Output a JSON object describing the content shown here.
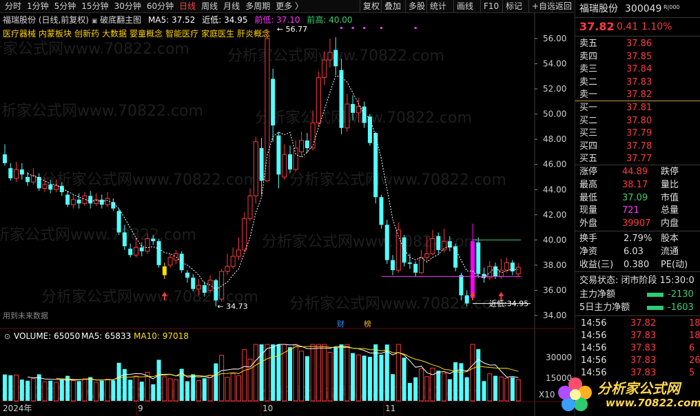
{
  "toolbar": {
    "timeframes": [
      "分时",
      "1分钟",
      "5分钟",
      "15分钟",
      "30分钟",
      "60分钟",
      "日线",
      "周线",
      "月线",
      "多周期",
      "更多 〉"
    ],
    "active_index": 6,
    "right_buttons": [
      "复权",
      "叠加",
      "多股",
      "统计",
      "画线",
      "F10",
      "标记",
      "+自选",
      "返回"
    ]
  },
  "header": {
    "stock_title": "福瑞股份 (日线,前复权)",
    "indicator": "破底翻主图",
    "ma5": "MA5: 37.52",
    "near_low": "近低: 34.95",
    "prev_low": "前低: 37.10",
    "prev_high": "前高: 40.00"
  },
  "tags": [
    "医疗器械",
    "内蒙板块",
    "创新药",
    "大数据",
    "婴童概念",
    "智能医疗",
    "家庭医生",
    "肝炎概念"
  ],
  "annotations": {
    "high_label": "56.77",
    "low_label": "34.73",
    "near_low_label": "近低:34.95",
    "future_data": "用到未来数据",
    "marker_cai": "财",
    "marker_bang": "榜"
  },
  "chart_data": [
    {
      "type": "candlestick",
      "ylim": [
        33.5,
        57
      ],
      "y_ticks": [
        "56.00",
        "54.00",
        "52.00",
        "50.00",
        "48.00",
        "46.00",
        "44.00",
        "42.00",
        "40.00",
        "38.00",
        "36.00",
        "34.00"
      ],
      "x_labels": [
        "2024年",
        "9",
        "10",
        "11"
      ],
      "candles": [
        {
          "o": 46.8,
          "c": 46.1,
          "h": 47.6,
          "l": 45.9
        },
        {
          "o": 45.7,
          "c": 44.9,
          "h": 46.1,
          "l": 44.7
        },
        {
          "o": 44.9,
          "c": 45.6,
          "h": 46.2,
          "l": 44.6
        },
        {
          "o": 45.6,
          "c": 45.2,
          "h": 46.1,
          "l": 44.8
        },
        {
          "o": 45.0,
          "c": 44.6,
          "h": 45.4,
          "l": 44.3
        },
        {
          "o": 44.6,
          "c": 45.1,
          "h": 45.7,
          "l": 44.4
        },
        {
          "o": 45.0,
          "c": 44.1,
          "h": 45.3,
          "l": 43.9
        },
        {
          "o": 44.1,
          "c": 44.4,
          "h": 44.9,
          "l": 43.8
        },
        {
          "o": 44.4,
          "c": 44.0,
          "h": 44.8,
          "l": 43.7
        },
        {
          "o": 44.0,
          "c": 44.3,
          "h": 44.8,
          "l": 43.8
        },
        {
          "o": 44.3,
          "c": 43.8,
          "h": 44.6,
          "l": 43.5
        },
        {
          "o": 43.6,
          "c": 42.8,
          "h": 43.9,
          "l": 42.6
        },
        {
          "o": 42.8,
          "c": 43.2,
          "h": 43.6,
          "l": 42.5
        },
        {
          "o": 43.2,
          "c": 42.9,
          "h": 43.7,
          "l": 42.5
        },
        {
          "o": 42.9,
          "c": 43.5,
          "h": 43.8,
          "l": 42.7
        },
        {
          "o": 43.5,
          "c": 42.9,
          "h": 43.9,
          "l": 42.5
        },
        {
          "o": 42.9,
          "c": 43.2,
          "h": 43.7,
          "l": 42.7
        },
        {
          "o": 43.2,
          "c": 42.8,
          "h": 43.6,
          "l": 42.5
        },
        {
          "o": 42.8,
          "c": 43.3,
          "h": 43.8,
          "l": 42.6
        },
        {
          "o": 43.0,
          "c": 42.5,
          "h": 43.3,
          "l": 42.3
        },
        {
          "o": 42.3,
          "c": 40.6,
          "h": 42.5,
          "l": 40.4
        },
        {
          "o": 40.6,
          "c": 39.5,
          "h": 41.2,
          "l": 39.2
        },
        {
          "o": 39.3,
          "c": 38.8,
          "h": 39.7,
          "l": 38.6
        },
        {
          "o": 38.8,
          "c": 39.4,
          "h": 40.2,
          "l": 38.6
        },
        {
          "o": 39.4,
          "c": 39.1,
          "h": 39.8,
          "l": 38.7
        },
        {
          "o": 39.1,
          "c": 40.1,
          "h": 40.5,
          "l": 38.9
        },
        {
          "o": 40.1,
          "c": 39.9,
          "h": 40.4,
          "l": 39.6
        },
        {
          "o": 39.9,
          "c": 38.0,
          "h": 40.1,
          "l": 37.8
        },
        {
          "o": 37.2,
          "c": 37.9,
          "h": 38.2,
          "l": 36.9,
          "color": "#ffe000"
        },
        {
          "o": 38.0,
          "c": 38.6,
          "h": 38.9,
          "l": 37.8
        },
        {
          "o": 38.4,
          "c": 38.9,
          "h": 39.2,
          "l": 38.1
        },
        {
          "o": 38.9,
          "c": 37.6,
          "h": 39.1,
          "l": 37.4
        },
        {
          "o": 37.4,
          "c": 37.0,
          "h": 37.6,
          "l": 36.6
        },
        {
          "o": 37.0,
          "c": 36.1,
          "h": 37.3,
          "l": 35.9
        },
        {
          "o": 36.1,
          "c": 36.4,
          "h": 36.9,
          "l": 35.6
        },
        {
          "o": 36.4,
          "c": 35.8,
          "h": 36.7,
          "l": 35.5
        },
        {
          "o": 36.0,
          "c": 36.8,
          "h": 37.2,
          "l": 35.8
        },
        {
          "o": 36.8,
          "c": 35.2,
          "h": 36.9,
          "l": 34.73
        },
        {
          "o": 35.3,
          "c": 37.5,
          "h": 37.7,
          "l": 35.1
        },
        {
          "o": 37.5,
          "c": 37.9,
          "h": 38.9,
          "l": 37.2
        },
        {
          "o": 37.9,
          "c": 38.7,
          "h": 39.4,
          "l": 37.7
        },
        {
          "o": 38.7,
          "c": 39.2,
          "h": 40.2,
          "l": 38.4
        },
        {
          "o": 39.2,
          "c": 41.7,
          "h": 42.2,
          "l": 39.1
        },
        {
          "o": 41.7,
          "c": 43.5,
          "h": 44.1,
          "l": 41.5
        },
        {
          "o": 43.5,
          "c": 47.8,
          "h": 48.2,
          "l": 42.9
        },
        {
          "o": 47.3,
          "c": 44.7,
          "h": 48.1,
          "l": 43.6
        },
        {
          "o": 44.7,
          "c": 56.0,
          "h": 56.77,
          "l": 44.6
        },
        {
          "o": 52.8,
          "c": 49.1,
          "h": 53.6,
          "l": 47.8
        },
        {
          "o": 48.3,
          "c": 45.2,
          "h": 48.6,
          "l": 44.1
        },
        {
          "o": 45.0,
          "c": 46.8,
          "h": 47.6,
          "l": 44.8
        },
        {
          "o": 46.8,
          "c": 45.6,
          "h": 47.5,
          "l": 45.3
        },
        {
          "o": 45.6,
          "c": 47.3,
          "h": 47.9,
          "l": 45.4
        },
        {
          "o": 47.0,
          "c": 47.9,
          "h": 48.6,
          "l": 46.6
        },
        {
          "o": 47.9,
          "c": 47.3,
          "h": 48.5,
          "l": 46.9
        },
        {
          "o": 47.3,
          "c": 49.3,
          "h": 50.3,
          "l": 47.1
        },
        {
          "o": 49.3,
          "c": 52.9,
          "h": 53.4,
          "l": 49.0
        },
        {
          "o": 52.9,
          "c": 54.3,
          "h": 55.0,
          "l": 52.3
        },
        {
          "o": 54.3,
          "c": 54.9,
          "h": 56.0,
          "l": 53.7
        },
        {
          "o": 55.1,
          "c": 53.8,
          "h": 56.1,
          "l": 53.1
        },
        {
          "o": 53.5,
          "c": 48.9,
          "h": 54.4,
          "l": 48.4
        },
        {
          "o": 48.9,
          "c": 50.8,
          "h": 51.6,
          "l": 48.6
        },
        {
          "o": 50.8,
          "c": 50.1,
          "h": 51.5,
          "l": 49.5
        },
        {
          "o": 50.1,
          "c": 50.6,
          "h": 51.3,
          "l": 49.3
        },
        {
          "o": 50.6,
          "c": 49.3,
          "h": 51.0,
          "l": 48.9
        },
        {
          "o": 49.8,
          "c": 47.7,
          "h": 50.0,
          "l": 47.5
        },
        {
          "o": 48.5,
          "c": 43.4,
          "h": 48.6,
          "l": 42.9
        },
        {
          "o": 43.4,
          "c": 41.2,
          "h": 43.6,
          "l": 40.9
        },
        {
          "o": 41.2,
          "c": 38.4,
          "h": 41.6,
          "l": 38.1
        },
        {
          "o": 38.4,
          "c": 37.6,
          "h": 38.8,
          "l": 37.2
        },
        {
          "o": 37.6,
          "c": 40.8,
          "h": 41.4,
          "l": 37.4
        },
        {
          "o": 40.2,
          "c": 38.2,
          "h": 40.4,
          "l": 37.9
        },
        {
          "o": 38.2,
          "c": 38.1,
          "h": 38.9,
          "l": 37.7
        },
        {
          "o": 38.1,
          "c": 37.4,
          "h": 38.3,
          "l": 37.1
        },
        {
          "o": 37.4,
          "c": 38.6,
          "h": 39.2,
          "l": 37.3
        },
        {
          "o": 38.6,
          "c": 38.9,
          "h": 40.3,
          "l": 38.3
        },
        {
          "o": 38.9,
          "c": 40.1,
          "h": 40.8,
          "l": 38.8
        },
        {
          "o": 40.3,
          "c": 39.2,
          "h": 40.6,
          "l": 38.9
        },
        {
          "o": 39.2,
          "c": 39.9,
          "h": 40.9,
          "l": 39.0
        },
        {
          "o": 39.9,
          "c": 39.4,
          "h": 40.3,
          "l": 39.1
        },
        {
          "o": 39.5,
          "c": 37.8,
          "h": 39.7,
          "l": 37.5
        },
        {
          "o": 37.2,
          "c": 35.6,
          "h": 37.4,
          "l": 35.2
        },
        {
          "o": 35.6,
          "c": 34.95,
          "h": 36.0,
          "l": 34.7
        },
        {
          "o": 35.4,
          "c": 39.9,
          "h": 41.3,
          "l": 35.2,
          "color": "#ff00ff"
        },
        {
          "o": 39.8,
          "c": 37.3,
          "h": 40.2,
          "l": 37.0
        },
        {
          "o": 37.3,
          "c": 37.0,
          "h": 37.8,
          "l": 36.6
        },
        {
          "o": 37.0,
          "c": 37.9,
          "h": 38.3,
          "l": 36.8
        },
        {
          "o": 37.9,
          "c": 37.1,
          "h": 38.2,
          "l": 36.9
        },
        {
          "o": 37.1,
          "c": 37.6,
          "h": 38.5,
          "l": 36.9
        },
        {
          "o": 37.6,
          "c": 38.2,
          "h": 38.6,
          "l": 37.4
        },
        {
          "o": 38.2,
          "c": 37.5,
          "h": 38.4,
          "l": 37.2
        },
        {
          "o": 37.3,
          "c": 37.82,
          "h": 38.17,
          "l": 37.09
        }
      ]
    },
    {
      "type": "bar",
      "title": "VOLUME",
      "y_ticks": [
        "30000",
        "15000",
        "X10"
      ]
    }
  ],
  "volume_legend": {
    "volume": "VOLUME: 65050",
    "ma5": "MA5: 65833",
    "ma10": "MA10: 97018"
  },
  "quote": {
    "name": "福瑞股份",
    "code": "300049",
    "badge": "R|000",
    "price": "37.82",
    "change": "0.41",
    "pct": "1.10%",
    "asks": [
      {
        "label": "卖五",
        "price": "37.86"
      },
      {
        "label": "卖四",
        "price": "37.85"
      },
      {
        "label": "卖三",
        "price": "37.84"
      },
      {
        "label": "卖二",
        "price": "37.83"
      },
      {
        "label": "卖一",
        "price": "37.82"
      }
    ],
    "bids": [
      {
        "label": "买一",
        "price": "37.81"
      },
      {
        "label": "买二",
        "price": "37.80"
      },
      {
        "label": "买三",
        "price": "37.79"
      },
      {
        "label": "买四",
        "price": "37.78"
      },
      {
        "label": "买五",
        "price": "37.77"
      }
    ],
    "stats": [
      {
        "label": "涨停",
        "value": "44.89",
        "label2": "跌停",
        "color": "#ff3b3b"
      },
      {
        "label": "最高",
        "value": "38.17",
        "label2": "量比",
        "color": "#ff3b3b"
      },
      {
        "label": "最低",
        "value": "37.09",
        "label2": "市值",
        "color": "#3bd16f"
      },
      {
        "label": "现量",
        "value": "721",
        "label2": "总量",
        "color": "#ff33ff"
      },
      {
        "label": "外盘",
        "value": "39907",
        "label2": "内盘",
        "color": "#ff3b3b"
      }
    ],
    "stats2": [
      {
        "label": "换手",
        "value": "2.79%",
        "label2": "股本",
        "color": "#dddddd"
      },
      {
        "label": "净资",
        "value": "6.03",
        "label2": "流通",
        "color": "#dddddd"
      },
      {
        "label": "收益(三)",
        "value": "0.380",
        "label2": "PE(动)",
        "color": "#dddddd"
      }
    ],
    "trade_state": "交易状态: 闭市阶段 15:30:0",
    "main_flow": {
      "label": "主力净额",
      "value": "-2130"
    },
    "flow5": {
      "label": "5日主力净额",
      "value": "-1603"
    },
    "ticks": [
      {
        "t": "14:56",
        "p": "37.82",
        "v": "18"
      },
      {
        "t": "14:56",
        "p": "37.83",
        "v": "18"
      },
      {
        "t": "14:56",
        "p": "37.83",
        "v": "6"
      },
      {
        "t": "14:56",
        "p": "37.83",
        "v": "26"
      },
      {
        "t": "14:56",
        "p": "37.83",
        "v": "5"
      }
    ]
  },
  "watermark": {
    "site": "分析家公式网",
    "url": "www.70822.com"
  }
}
